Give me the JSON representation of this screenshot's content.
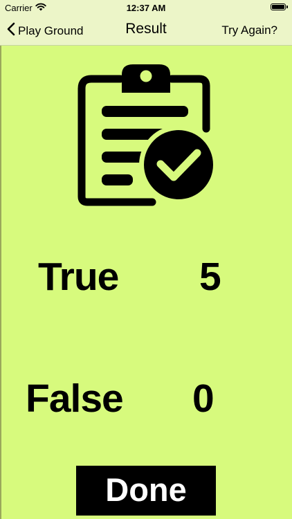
{
  "status_bar": {
    "carrier": "Carrier",
    "time": "12:37 AM",
    "battery_level": 1.0
  },
  "nav": {
    "back_label": "Play Ground",
    "title": "Result",
    "right_label": "Try Again?"
  },
  "icons": {
    "back": "chevron-left-icon",
    "wifi": "wifi-icon",
    "battery": "battery-icon",
    "result": "clipboard-check-icon"
  },
  "results": {
    "true_label": "True",
    "true_value": "5",
    "false_label": "False",
    "false_value": "0"
  },
  "actions": {
    "done_label": "Done"
  },
  "colors": {
    "background": "#d7fa7d",
    "bar_background": "#ecf5c8",
    "button": "#000000",
    "button_text": "#ffffff"
  }
}
